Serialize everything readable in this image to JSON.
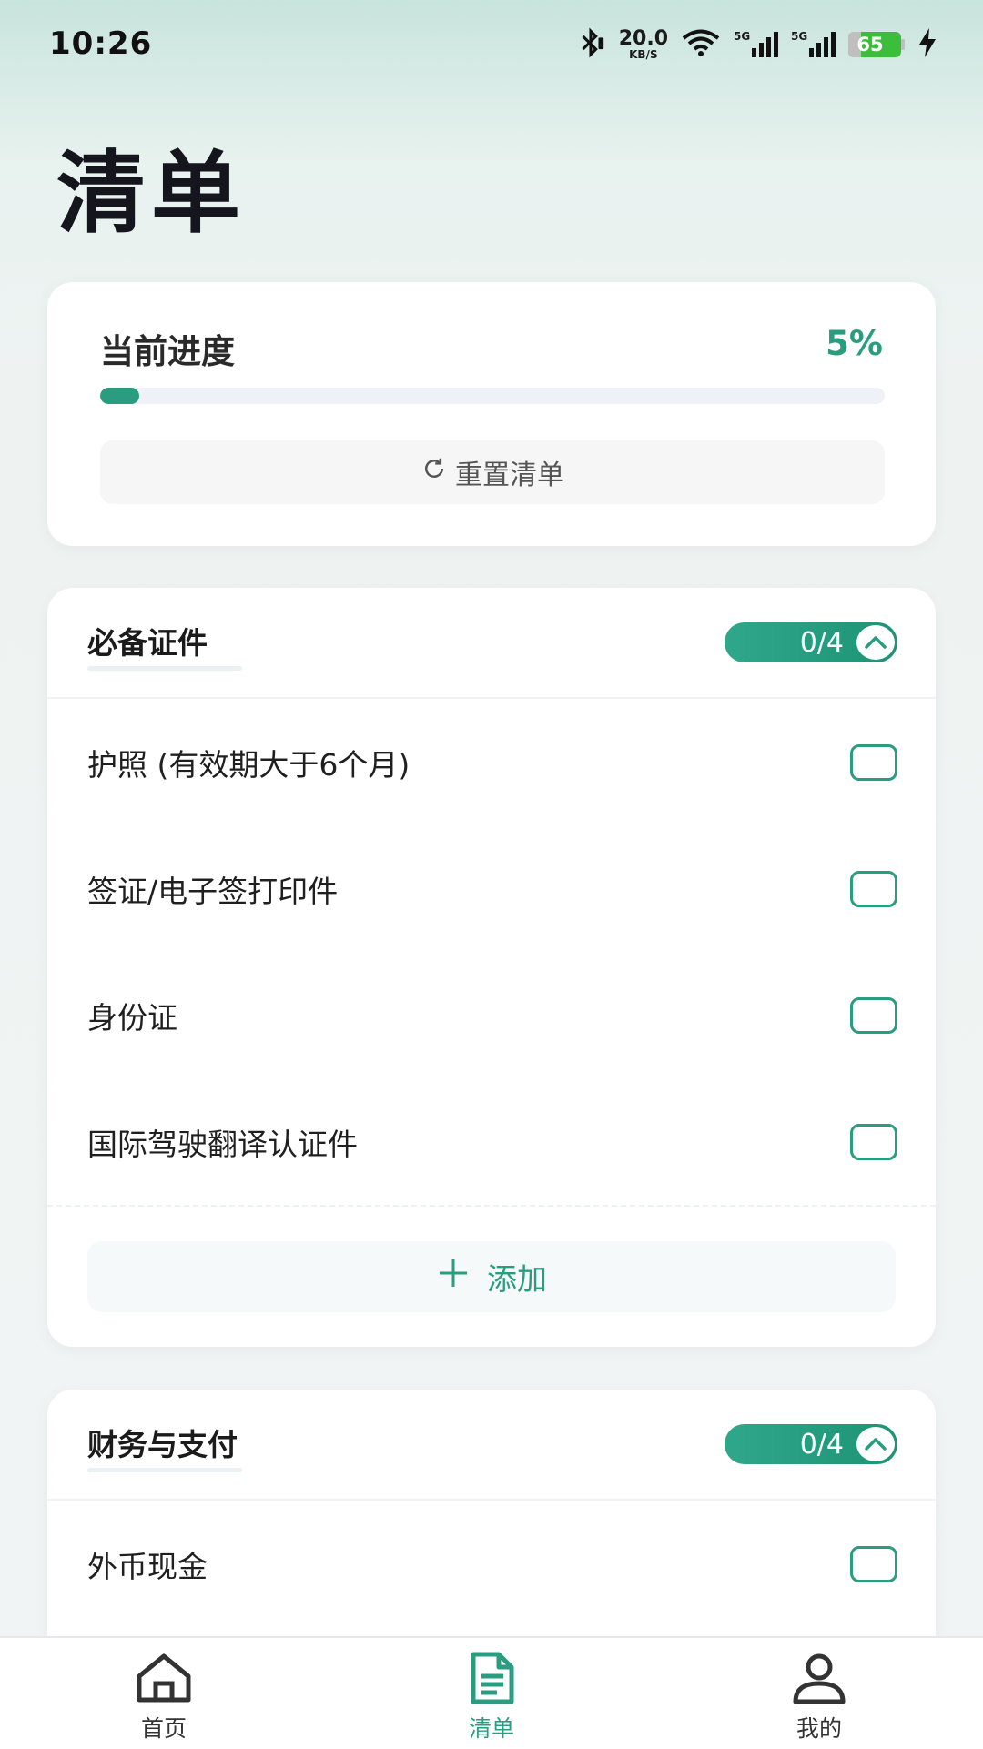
{
  "status_bar": {
    "time": "10:26",
    "net_speed_value": "20.0",
    "net_speed_unit": "KB/S",
    "signal1_label": "5G",
    "signal2_label": "5G",
    "battery_level": "65"
  },
  "page": {
    "title": "清单"
  },
  "progress": {
    "label": "当前进度",
    "percent_text": "5%",
    "percent": 5,
    "reset_label": "重置清单"
  },
  "categories": [
    {
      "title": "必备证件",
      "count": "0/4",
      "items": [
        {
          "label": "护照 (有效期大于6个月)",
          "checked": false
        },
        {
          "label": "签证/电子签打印件",
          "checked": false
        },
        {
          "label": "身份证",
          "checked": false
        },
        {
          "label": "国际驾驶翻译认证件",
          "checked": false
        }
      ],
      "add_label": "添加"
    },
    {
      "title": "财务与支付",
      "count": "0/4",
      "items": [
        {
          "label": "外币现金",
          "checked": false
        }
      ]
    }
  ],
  "bottom_nav": [
    {
      "label": "首页",
      "icon": "home-icon",
      "active": false
    },
    {
      "label": "清单",
      "icon": "checklist-icon",
      "active": true
    },
    {
      "label": "我的",
      "icon": "profile-icon",
      "active": false
    }
  ],
  "colors": {
    "accent": "#2a9d81",
    "background": "#eef3f2"
  }
}
